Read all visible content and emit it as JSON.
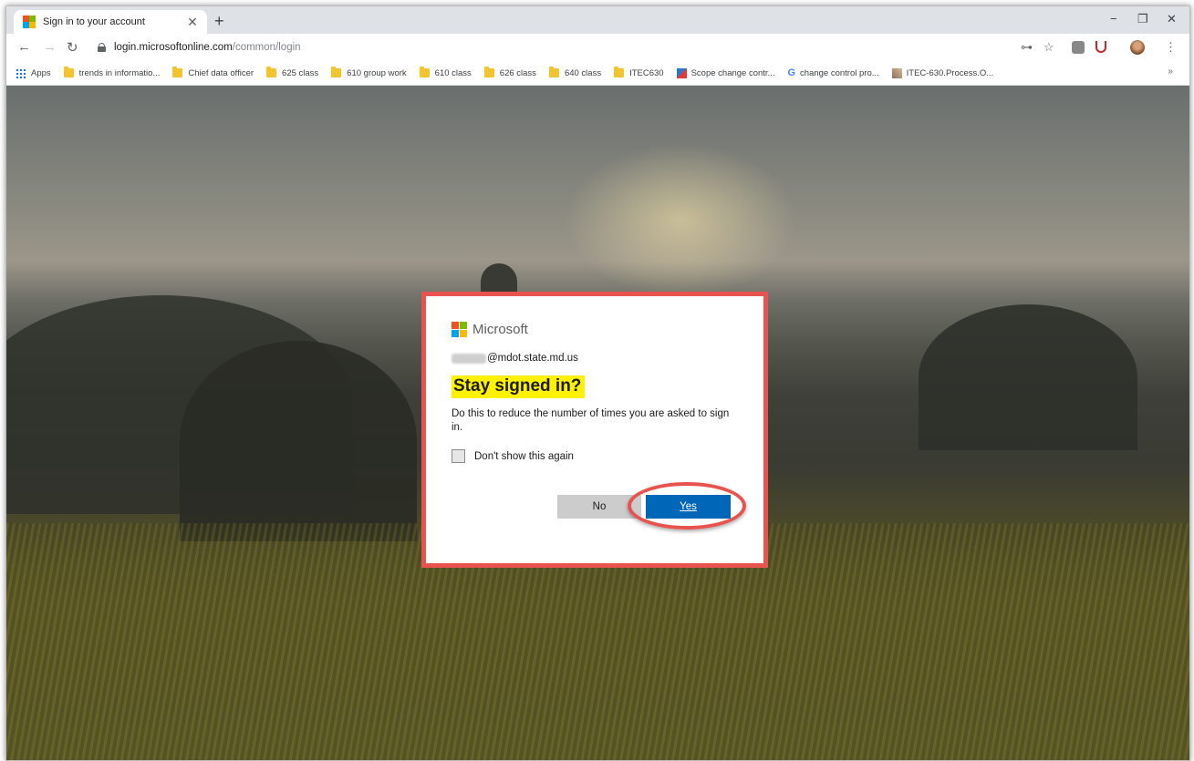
{
  "browser": {
    "tab": {
      "title": "Sign in to your account",
      "close": "✕"
    },
    "new_tab": "+",
    "window_controls": {
      "minimize": "−",
      "restore": "❐",
      "close": "✕"
    },
    "nav": {
      "back": "←",
      "forward": "→",
      "reload": "↻"
    },
    "url": {
      "host": "login.microsoftonline.com",
      "path": "/common/login"
    },
    "toolbar_icons": {
      "key": "⊶",
      "star": "☆",
      "menu": "⋮"
    }
  },
  "bookmarks": [
    {
      "label": "Apps",
      "icon": "apps-icon"
    },
    {
      "label": "trends in informatio...",
      "icon": "folder-icon"
    },
    {
      "label": "Chief data officer",
      "icon": "folder-icon"
    },
    {
      "label": "625 class",
      "icon": "folder-icon"
    },
    {
      "label": "610 group work",
      "icon": "folder-icon"
    },
    {
      "label": "610 class",
      "icon": "folder-icon"
    },
    {
      "label": "626 class",
      "icon": "folder-icon"
    },
    {
      "label": "640 class",
      "icon": "folder-icon"
    },
    {
      "label": "ITEC630",
      "icon": "folder-icon"
    },
    {
      "label": "Scope change contr...",
      "icon": "site-icon"
    },
    {
      "label": "change control pro...",
      "icon": "google-icon"
    },
    {
      "label": "ITEC-630.Process.O...",
      "icon": "site-icon"
    }
  ],
  "bookmarks_more": "»",
  "dialog": {
    "brand": "Microsoft",
    "account_domain": "@mdot.state.md.us",
    "title": "Stay signed in?",
    "description": "Do this to reduce the number of times you are asked to sign in.",
    "checkbox_label": "Don't show this again",
    "no_label": "No",
    "yes_label": "Yes"
  },
  "colors": {
    "ms_red": "#f25022",
    "ms_green": "#7fba00",
    "ms_blue": "#00a4ef",
    "ms_yellow": "#ffb900",
    "primary_button": "#0067b8",
    "annotation": "#e8534f",
    "highlight": "#fff200"
  }
}
